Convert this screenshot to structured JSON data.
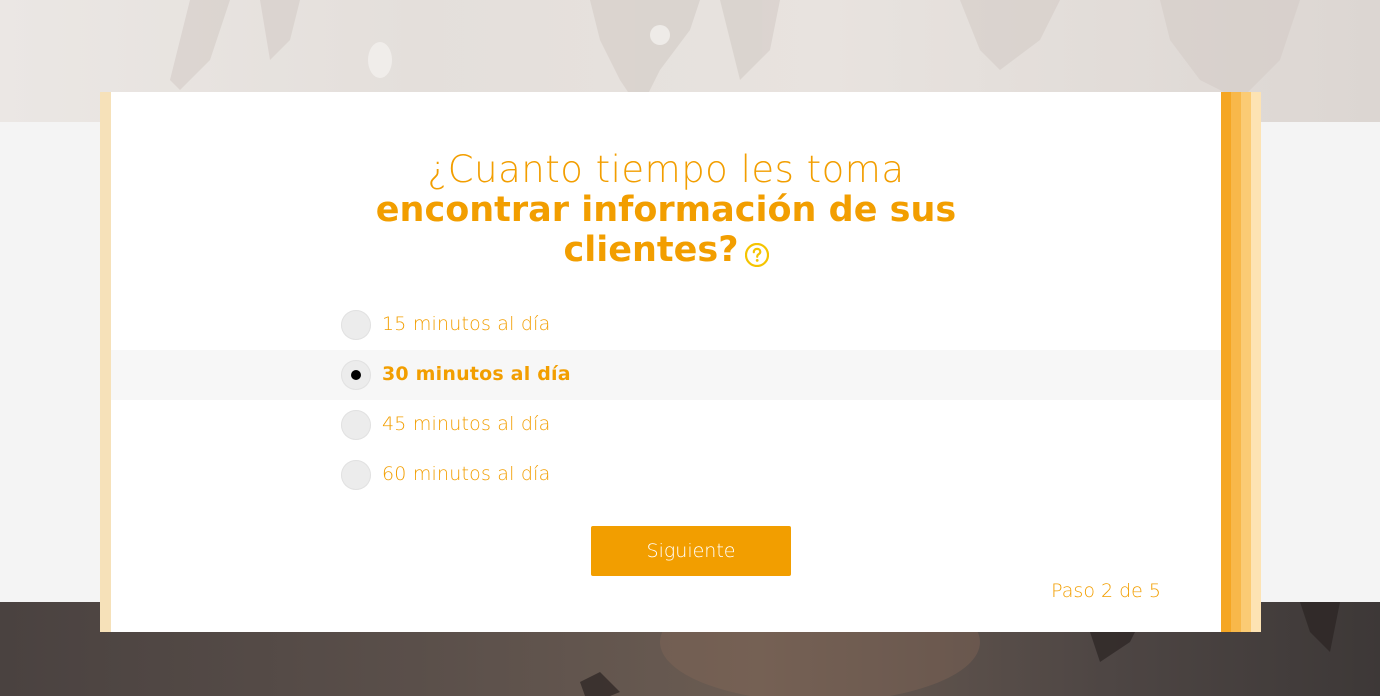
{
  "question": {
    "line1": "¿Cuanto tiempo les toma",
    "line2": "encontrar información de sus",
    "line3": "clientes?"
  },
  "help_icon": "question-circle-icon",
  "options": [
    {
      "label": "15 minutos al día",
      "selected": false
    },
    {
      "label": "30 minutos al día",
      "selected": true
    },
    {
      "label": "45 minutos al día",
      "selected": false
    },
    {
      "label": "60 minutos al día",
      "selected": false
    }
  ],
  "next_button": {
    "label": "Siguiente"
  },
  "step_indicator": "Paso 2 de 5",
  "colors": {
    "accent": "#f29e00",
    "help_icon": "#f5c400",
    "card_bg": "#ffffff",
    "left_stripe": "#f6e1b9",
    "right_stripes": [
      "#f5a623",
      "#f8b84a",
      "#fbcb74",
      "#fde3b3"
    ]
  }
}
